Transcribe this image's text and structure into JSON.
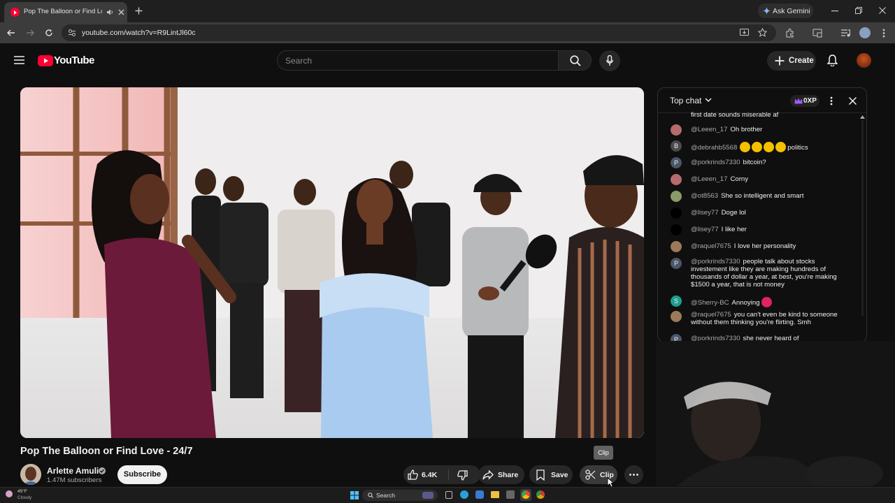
{
  "browser": {
    "tab_title": "Pop The Balloon or Find Lo",
    "url": "youtube.com/watch?v=R9LintJl60c",
    "gemini_label": "Ask Gemini"
  },
  "header": {
    "logo_text": "YouTube",
    "search_placeholder": "Search",
    "create_label": "Create"
  },
  "chat": {
    "mode_label": "Top chat",
    "xp_label": "0XP",
    "cut_message": "first date sounds miserable af",
    "messages": [
      {
        "author": "@Leeen_17",
        "text": "Oh brother",
        "avatar_color": "#b56b6b",
        "initial": ""
      },
      {
        "author": "@debrahb5568",
        "text": "politics",
        "avatar_color": "#4a4a4a",
        "initial": "B",
        "emojis": 4
      },
      {
        "author": "@porkrinds7330",
        "text": "bitcoin?",
        "avatar_color": "#4a5568",
        "initial": "P"
      },
      {
        "author": "@Leeen_17",
        "text": "Corny",
        "avatar_color": "#b56b6b",
        "initial": ""
      },
      {
        "author": "@ot8563",
        "text": "She so intelligent and smart",
        "avatar_color": "#8a9a6a",
        "initial": ""
      },
      {
        "author": "@lisey77",
        "text": "Doge lol",
        "avatar_color": "#111111",
        "initial": ""
      },
      {
        "author": "@lisey77",
        "text": "I like her",
        "avatar_color": "#111111",
        "initial": ""
      },
      {
        "author": "@raquel7675",
        "text": "I love her personality",
        "avatar_color": "#9a7a5a",
        "initial": ""
      },
      {
        "author": "@porkrinds7330",
        "text": "people talk about stocks investement like they are making hundreds of thousands of dollar a year, at best, you're making $1500 a year, that is not money",
        "avatar_color": "#4a5568",
        "initial": "P"
      },
      {
        "author": "@Sherry-BC",
        "text": "Annoying",
        "avatar_color": "#1e9e8e",
        "initial": "S"
      },
      {
        "author": "@raquel7675",
        "text": "you can't even be kind to someone without them thinking you're flirting. Smh",
        "avatar_color": "#9a7a5a",
        "initial": ""
      },
      {
        "author": "@porkrinds7330",
        "text": "she never heard of",
        "avatar_color": "#4a5568",
        "initial": "P"
      }
    ]
  },
  "video": {
    "title": "Pop The Balloon or Find Love - 24/7",
    "channel_name": "Arlette Amuli",
    "subscribers": "1.47M subscribers",
    "subscribe_label": "Subscribe",
    "like_count": "6.4K",
    "share_label": "Share",
    "save_label": "Save",
    "clip_label": "Clip",
    "tooltip": "Clip"
  },
  "taskbar": {
    "weather_temp": "45°F",
    "weather_desc": "Cloudy",
    "search_label": "Search"
  },
  "colors": {
    "accent_red": "#ff0033",
    "background": "#0f0f0f",
    "pill": "#272727"
  }
}
